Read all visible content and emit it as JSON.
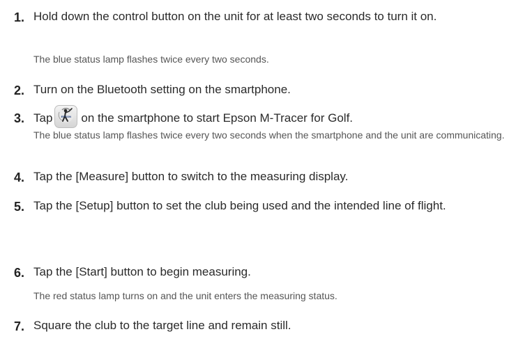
{
  "steps": [
    {
      "num": "1.",
      "text": "Hold down the control button on the unit for at least two seconds to turn it on.",
      "note": "The blue status lamp flashes twice every two seconds."
    },
    {
      "num": "2.",
      "text": "Turn on the Bluetooth setting on the smartphone.",
      "note": ""
    },
    {
      "num": "3.",
      "text_before": "Tap",
      "text_after": "on the smartphone to start Epson M-Tracer for Golf.",
      "icon": "golf-swing-app-icon",
      "icon_label": "EPSON",
      "note": "The blue status lamp flashes twice every two seconds when the smartphone and the unit are communicating."
    },
    {
      "num": "4.",
      "text": "Tap the [Measure] button to switch to the measuring display.",
      "note": ""
    },
    {
      "num": "5.",
      "text": "Tap the [Setup] button to set the club being used and the intended line of flight.",
      "note": ""
    },
    {
      "num": "6.",
      "text": "Tap the [Start] button to begin measuring.",
      "note": "The red status lamp turns on and the unit enters the measuring status."
    },
    {
      "num": "7.",
      "text": "Square the club to the target line and remain still.",
      "note": ""
    }
  ]
}
